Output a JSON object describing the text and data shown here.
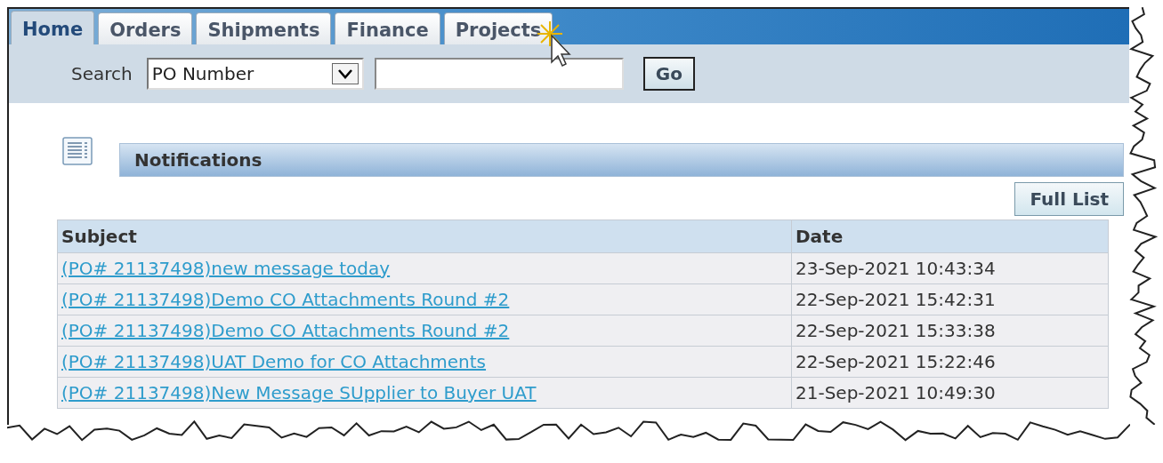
{
  "tabs": [
    {
      "label": "Home",
      "selected": true
    },
    {
      "label": "Orders",
      "selected": false
    },
    {
      "label": "Shipments",
      "selected": false
    },
    {
      "label": "Finance",
      "selected": false
    },
    {
      "label": "Projects",
      "selected": false
    }
  ],
  "search": {
    "label": "Search",
    "dropdown_value": "PO Number",
    "button": "Go"
  },
  "notifications": {
    "title": "Notifications",
    "button": "Full List",
    "columns": [
      "Subject",
      "Date"
    ],
    "rows": [
      {
        "subject": "(PO# 21137498)new message today",
        "date": "23-Sep-2021 10:43:34"
      },
      {
        "subject": "(PO# 21137498)Demo CO Attachments Round #2",
        "date": "22-Sep-2021 15:42:31"
      },
      {
        "subject": "(PO# 21137498)Demo CO Attachments Round #2",
        "date": "22-Sep-2021 15:33:38"
      },
      {
        "subject": "(PO# 21137498)UAT Demo for CO Attachments",
        "date": "22-Sep-2021 15:22:46"
      },
      {
        "subject": "(PO# 21137498)New Message SUpplier to Buyer UAT",
        "date": "21-Sep-2021 10:49:30"
      }
    ]
  }
}
